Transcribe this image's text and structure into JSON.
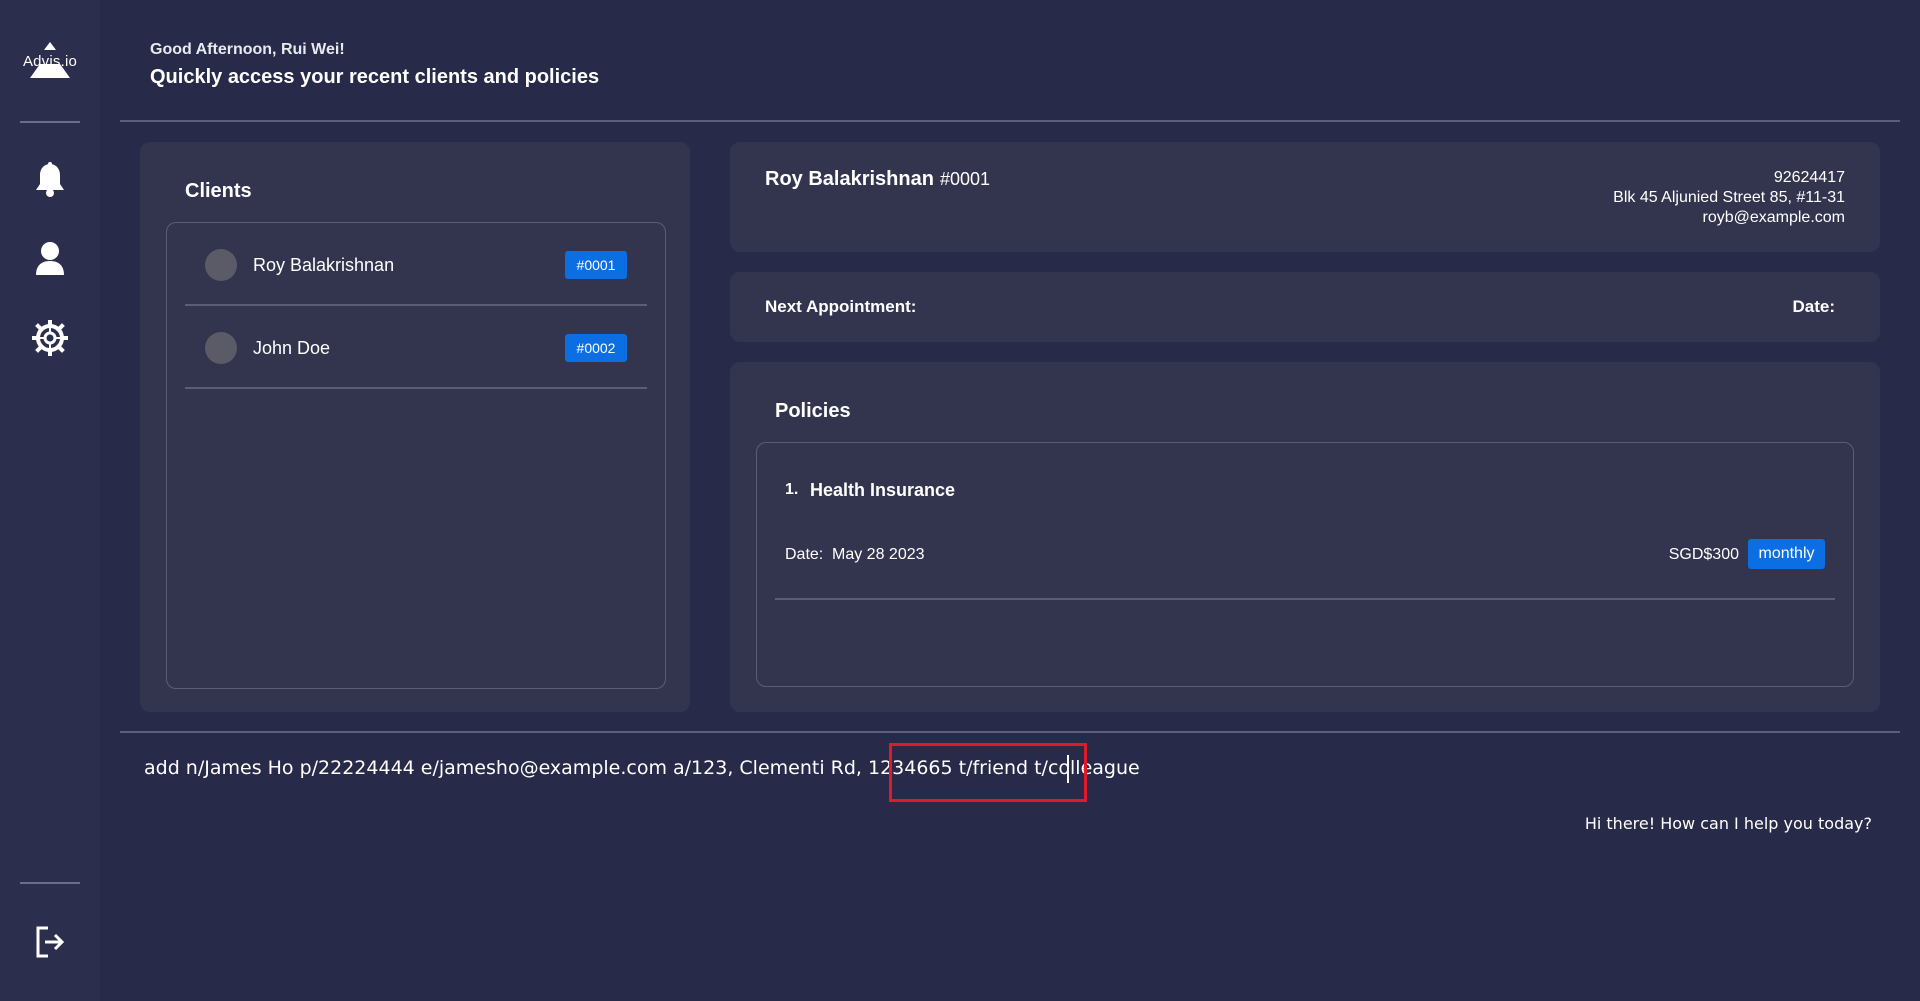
{
  "app": {
    "logo_text": "Advis.io"
  },
  "sidebar": {
    "items": [
      {
        "name": "notifications",
        "icon": "bell-icon"
      },
      {
        "name": "profile",
        "icon": "user-icon"
      },
      {
        "name": "settings",
        "icon": "gear-icon"
      }
    ],
    "logout_icon": "logout-icon"
  },
  "header": {
    "greeting": "Good Afternoon, Rui Wei!",
    "title": "Quickly access your recent clients and policies"
  },
  "clients": {
    "title": "Clients",
    "items": [
      {
        "name": "Roy Balakrishnan",
        "id": "#0001"
      },
      {
        "name": "John Doe",
        "id": "#0002"
      }
    ]
  },
  "client_detail": {
    "name": "Roy Balakrishnan",
    "id": "#0001",
    "phone": "92624417",
    "address": "Blk 45 Aljunied Street 85, #11-31",
    "email": "royb@example.com"
  },
  "appointment": {
    "label": "Next Appointment:",
    "date_label": "Date:"
  },
  "policies": {
    "title": "Policies",
    "items": [
      {
        "index": "1.",
        "name": "Health Insurance",
        "date_label": "Date:",
        "date": "May 28 2023",
        "amount": "SGD$300",
        "frequency": "monthly"
      }
    ]
  },
  "command": {
    "value": "add n/James Ho p/22224444 e/jamesho@example.com a/123, Clementi Rd, 1234665 t/friend t/colleague",
    "response": "Hi there! How can I help you today?"
  },
  "colors": {
    "background": "#272a48",
    "panel": "#33354f",
    "accent": "#0b6ee3",
    "highlight": "#e0192b"
  }
}
